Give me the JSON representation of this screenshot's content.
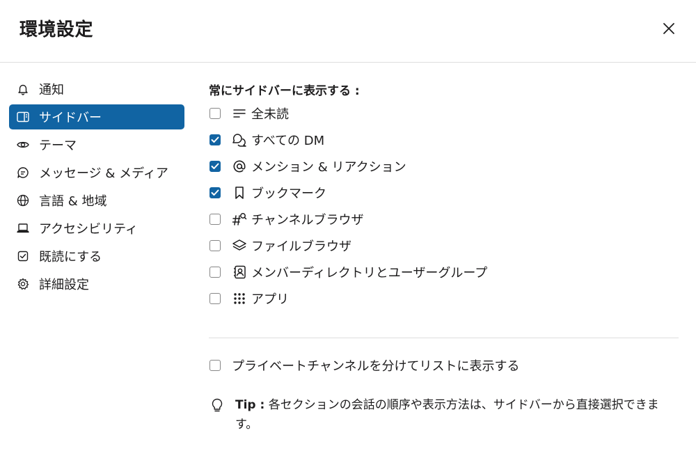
{
  "header": {
    "title": "環境設定",
    "close_icon": "close-icon"
  },
  "nav": {
    "items": [
      {
        "label": "通知",
        "icon": "bell-icon",
        "active": false
      },
      {
        "label": "サイドバー",
        "icon": "sidebar-icon",
        "active": true
      },
      {
        "label": "テーマ",
        "icon": "eye-icon",
        "active": false
      },
      {
        "label": "メッセージ & メディア",
        "icon": "message-icon",
        "active": false
      },
      {
        "label": "言語 & 地域",
        "icon": "globe-icon",
        "active": false
      },
      {
        "label": "アクセシビリティ",
        "icon": "laptop-icon",
        "active": false
      },
      {
        "label": "既読にする",
        "icon": "check-square-icon",
        "active": false
      },
      {
        "label": "詳細設定",
        "icon": "gear-icon",
        "active": false
      }
    ]
  },
  "main": {
    "section_title": "常にサイドバーに表示する :",
    "options": [
      {
        "label": "全未読",
        "icon": "unreads-icon",
        "checked": false
      },
      {
        "label": "すべての DM",
        "icon": "dm-icon",
        "checked": true
      },
      {
        "label": "メンション & リアクション",
        "icon": "at-icon",
        "checked": true
      },
      {
        "label": "ブックマーク",
        "icon": "bookmark-icon",
        "checked": true
      },
      {
        "label": "チャンネルブラウザ",
        "icon": "channel-search-icon",
        "checked": false
      },
      {
        "label": "ファイルブラウザ",
        "icon": "layers-icon",
        "checked": false
      },
      {
        "label": "メンバーディレクトリとユーザーグループ",
        "icon": "contact-card-icon",
        "checked": false
      },
      {
        "label": "アプリ",
        "icon": "apps-grid-icon",
        "checked": false
      }
    ],
    "private_channels": {
      "label": "プライベートチャンネルを分けてリストに表示する",
      "checked": false
    },
    "tip": {
      "icon": "lightbulb-icon",
      "label": "Tip :",
      "text": " 各セクションの会話の順序や表示方法は、サイドバーから直接選択できます。"
    }
  },
  "colors": {
    "accent": "#1164a3",
    "checkbox": "#1264a3",
    "divider": "#dddddd"
  }
}
